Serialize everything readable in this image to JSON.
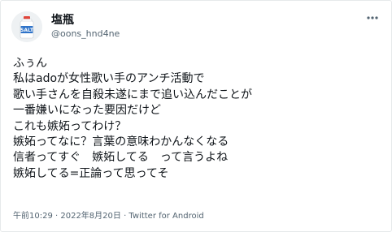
{
  "tweet": {
    "author_name": "塩瓶",
    "author_handle": "@oons_hnd4ne",
    "avatar_label": "SALT",
    "lines": [
      "ふぅん",
      "私はadoが女性歌い手のアンチ活動で",
      "歌い手さんを自殺未遂にまで追い込んだことが",
      "一番嫌いになった要因だけど",
      "これも嫉妬ってわけ？",
      "嫉妬ってなに？言葉の意味わかんなくなる",
      "信者ってすぐ　嫉妬してる　って言うよね",
      "嫉妬してる=正論って思ってそ"
    ],
    "timestamp": "午前10:29 · 2022年8月20日 · Twitter for Android"
  },
  "icons": {
    "more": "more-dots-icon"
  },
  "colors": {
    "text": "#0f1419",
    "secondary": "#536471",
    "salt_cap": "#e0453a",
    "salt_body": "#2f73c9"
  }
}
